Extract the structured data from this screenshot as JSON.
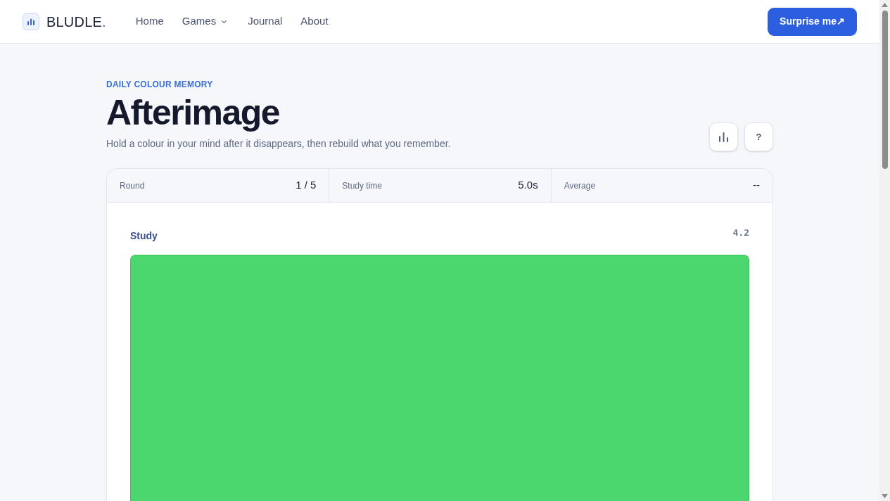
{
  "header": {
    "logo": {
      "text": "BLUDLE",
      "accent": "."
    },
    "nav": [
      {
        "label": "Home",
        "kind": "link"
      },
      {
        "label": "Games",
        "kind": "dropdown"
      },
      {
        "label": "Journal",
        "kind": "link"
      },
      {
        "label": "About",
        "kind": "link"
      }
    ],
    "cta": {
      "label": "Surprise me↗"
    }
  },
  "intro": {
    "eyebrow": "DAILY COLOUR MEMORY",
    "title": "Afterimage",
    "subtitle": "Hold a colour in your mind after it disappears, then rebuild what you remember.",
    "actions": [
      {
        "kind": "stats"
      },
      {
        "kind": "help",
        "label": "?"
      }
    ]
  },
  "stats": [
    {
      "label": "Round",
      "value": "1 / 5"
    },
    {
      "label": "Study time",
      "value": "5.0s"
    },
    {
      "label": "Average",
      "value": "--"
    }
  ],
  "study": {
    "label": "Study",
    "timer": "4.2",
    "color": "#4cd66e"
  }
}
